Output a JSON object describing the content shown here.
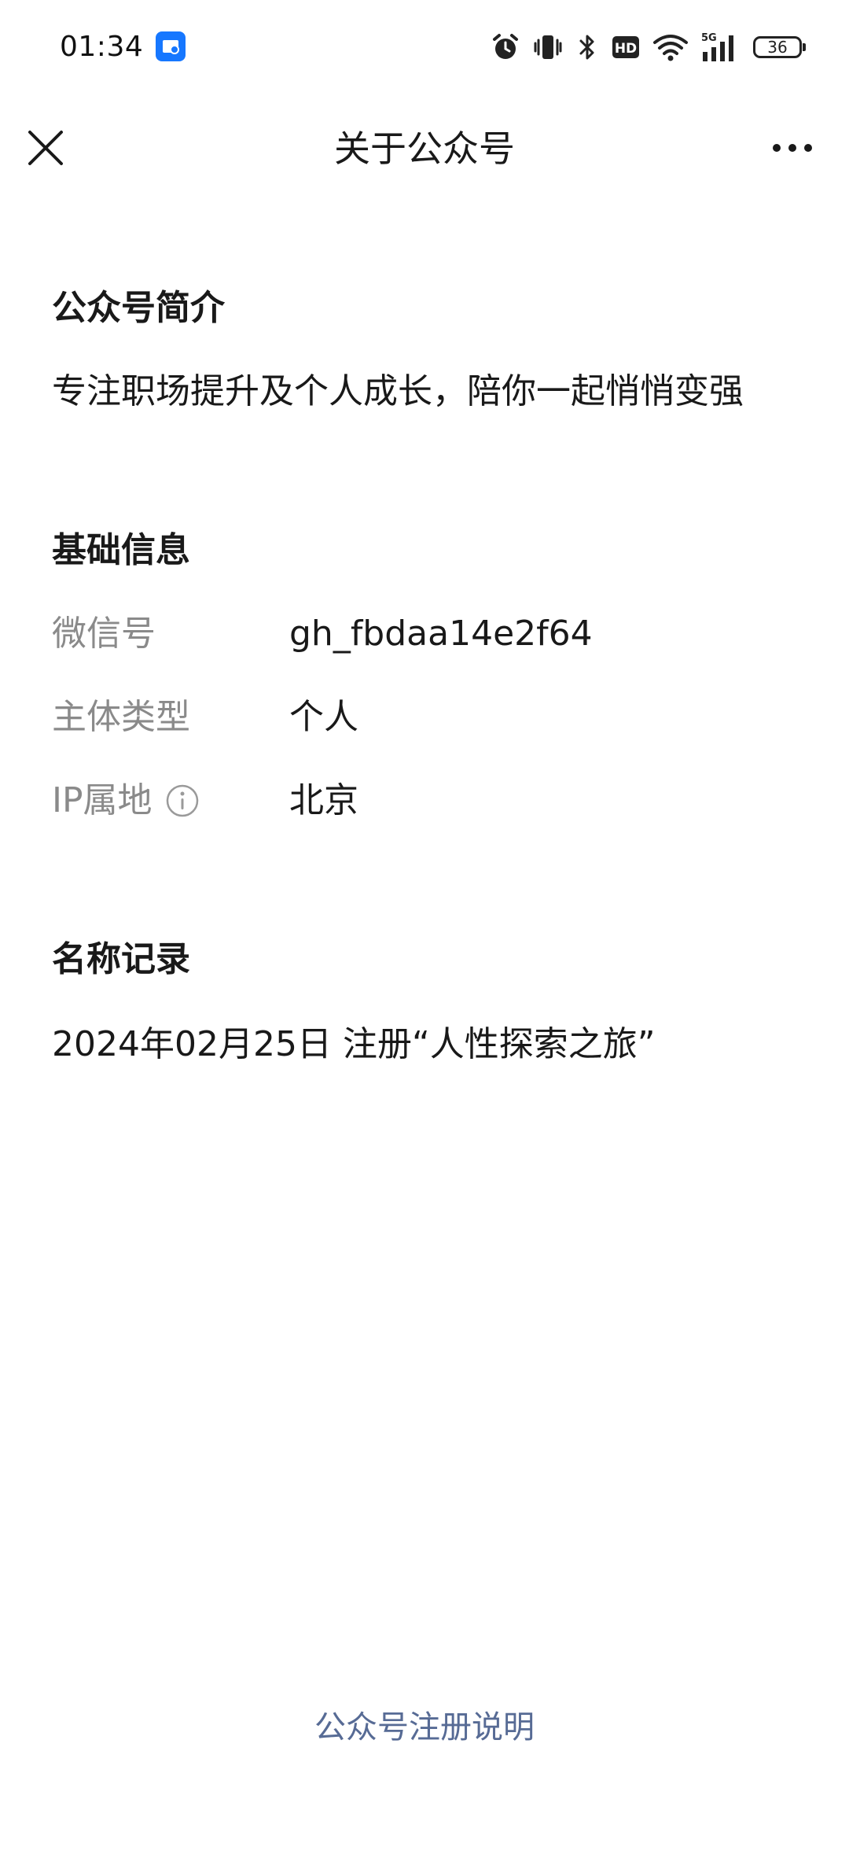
{
  "status_bar": {
    "time": "01:34",
    "battery_level": "36",
    "icons": [
      "app-notification-icon",
      "alarm-icon",
      "vibrate-icon",
      "bluetooth-icon",
      "hd-icon",
      "wifi-icon",
      "signal-5g-icon",
      "battery-icon"
    ],
    "hd_label": "HD",
    "network_label": "5G"
  },
  "nav": {
    "title": "关于公众号"
  },
  "intro": {
    "title": "公众号简介",
    "text": "专注职场提升及个人成长，陪你一起悄悄变强"
  },
  "basic_info": {
    "title": "基础信息",
    "rows": [
      {
        "label": "微信号",
        "value": "gh_fbdaa14e2f64"
      },
      {
        "label": "主体类型",
        "value": "个人"
      },
      {
        "label": "IP属地",
        "value": "北京"
      }
    ]
  },
  "name_record": {
    "title": "名称记录",
    "entry": "2024年02月25日 注册“人性探索之旅”"
  },
  "footer": {
    "link_label": "公众号注册说明"
  },
  "colors": {
    "accent_link": "#576b95",
    "label_gray": "#8a8a8a",
    "text": "#191919",
    "app_icon_blue": "#1677ff"
  }
}
